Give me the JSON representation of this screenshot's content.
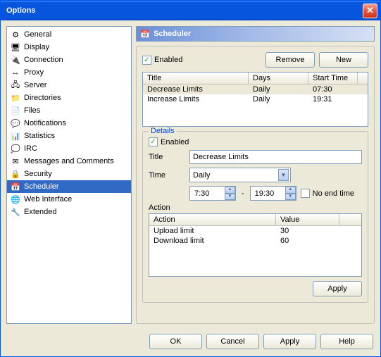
{
  "window": {
    "title": "Options"
  },
  "sidebar": {
    "items": [
      {
        "label": "General",
        "icon": "⚙"
      },
      {
        "label": "Display",
        "icon": "🖥"
      },
      {
        "label": "Connection",
        "icon": "🔌"
      },
      {
        "label": "Proxy",
        "icon": "↔"
      },
      {
        "label": "Server",
        "icon": "🖧"
      },
      {
        "label": "Directories",
        "icon": "📁"
      },
      {
        "label": "Files",
        "icon": "📄"
      },
      {
        "label": "Notifications",
        "icon": "💬"
      },
      {
        "label": "Statistics",
        "icon": "📊"
      },
      {
        "label": "IRC",
        "icon": "💭"
      },
      {
        "label": "Messages and Comments",
        "icon": "✉"
      },
      {
        "label": "Security",
        "icon": "🔒"
      },
      {
        "label": "Scheduler",
        "icon": "📅",
        "selected": true
      },
      {
        "label": "Web Interface",
        "icon": "🌐"
      },
      {
        "label": "Extended",
        "icon": "🔧"
      }
    ]
  },
  "header": {
    "title": "Scheduler",
    "icon": "📅"
  },
  "top": {
    "enabled_label": "Enabled",
    "enabled_checked": true,
    "remove_label": "Remove",
    "new_label": "New"
  },
  "schedule_table": {
    "columns": [
      "Title",
      "Days",
      "Start Time"
    ],
    "rows": [
      {
        "title": "Decrease Limits",
        "days": "Daily",
        "start": "07:30",
        "selected": true
      },
      {
        "title": "Increase Limits",
        "days": "Daily",
        "start": "19:31"
      }
    ]
  },
  "details": {
    "legend": "Details",
    "enabled_label": "Enabled",
    "enabled_checked": true,
    "title_label": "Title",
    "title_value": "Decrease Limits",
    "time_label": "Time",
    "time_select": "Daily",
    "start_time": "7:30",
    "end_time": "19:30",
    "no_end_label": "No end time",
    "no_end_checked": false,
    "action_label": "Action",
    "action_table": {
      "columns": [
        "Action",
        "Value"
      ],
      "rows": [
        {
          "action": "Upload limit",
          "value": "30"
        },
        {
          "action": "Download limit",
          "value": "60"
        }
      ]
    },
    "apply_label": "Apply"
  },
  "footer": {
    "ok": "OK",
    "cancel": "Cancel",
    "apply": "Apply",
    "help": "Help"
  }
}
